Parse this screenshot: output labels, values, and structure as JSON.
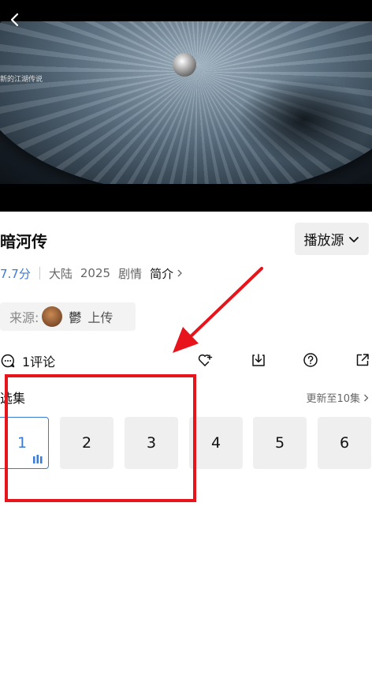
{
  "player": {
    "overlay_text": "新的江湖传说"
  },
  "show": {
    "title": "暗河传",
    "source_button_label": "播放源",
    "score": "7.7分",
    "region": "大陆",
    "year": "2025",
    "genre": "剧情",
    "intro_label": "简介"
  },
  "uploader": {
    "label": "来源:",
    "name": "鬱",
    "action": "上传"
  },
  "actions": {
    "comments": "1评论",
    "icons": [
      "heart-plus-icon",
      "download-icon",
      "help-icon",
      "share-icon"
    ]
  },
  "episodes": {
    "title": "选集",
    "update_info": "更新至10集",
    "items": [
      "1",
      "2",
      "3",
      "4",
      "5",
      "6"
    ],
    "active_index": 0
  },
  "colors": {
    "accent": "#3a7bd5",
    "annotation": "#e8141b"
  }
}
